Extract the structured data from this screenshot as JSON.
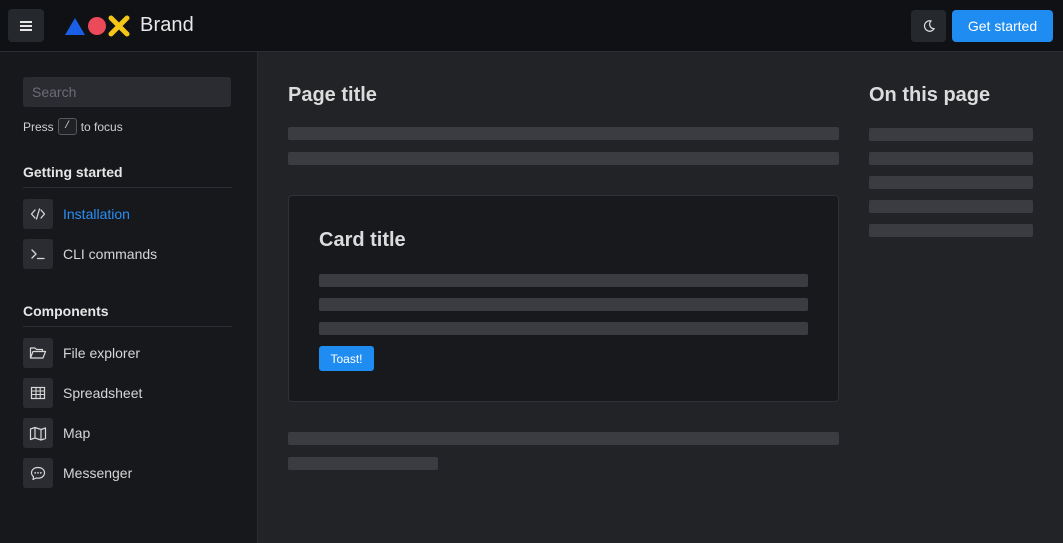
{
  "header": {
    "brand": "Brand",
    "cta_label": "Get started",
    "colors": {
      "logo_triangle": "#1b5fe6",
      "logo_circle": "#ea4a5a",
      "logo_x": "#f5c518",
      "accent": "#1e8cf0"
    },
    "icons": [
      "menu-icon",
      "moon-icon"
    ]
  },
  "sidebar": {
    "search_placeholder": "Search",
    "hint_prefix": "Press",
    "hint_key": "/",
    "hint_suffix": "to focus",
    "sections": [
      {
        "title": "Getting started",
        "items": [
          {
            "label": "Installation",
            "icon": "code-icon",
            "active": true
          },
          {
            "label": "CLI commands",
            "icon": "terminal-icon",
            "active": false
          }
        ]
      },
      {
        "title": "Components",
        "items": [
          {
            "label": "File explorer",
            "icon": "folder-open-icon",
            "active": false
          },
          {
            "label": "Spreadsheet",
            "icon": "table-icon",
            "active": false
          },
          {
            "label": "Map",
            "icon": "map-icon",
            "active": false
          },
          {
            "label": "Messenger",
            "icon": "chat-icon",
            "active": false
          }
        ]
      }
    ]
  },
  "main": {
    "page_title": "Page title",
    "card": {
      "title": "Card title",
      "button_label": "Toast!"
    }
  },
  "toc": {
    "title": "On this page"
  }
}
